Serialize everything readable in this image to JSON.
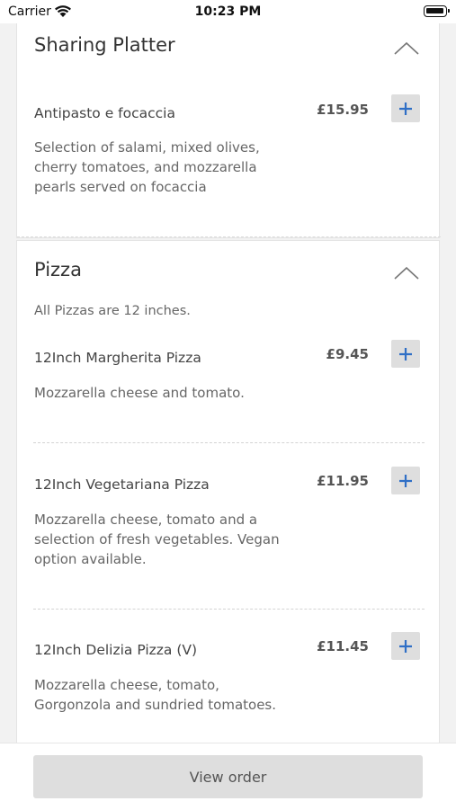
{
  "status_bar": {
    "carrier": "Carrier",
    "time": "10:23 PM"
  },
  "sections": [
    {
      "title": "Sharing Platter",
      "items": [
        {
          "name": "Antipasto e focaccia",
          "price": "£15.95",
          "description": "Selection of salami, mixed olives, cherry tomatoes, and mozzarella pearls served on focaccia"
        }
      ]
    },
    {
      "title": "Pizza",
      "subtitle": "All Pizzas are 12 inches.",
      "items": [
        {
          "name": "12Inch Margherita Pizza",
          "price": "£9.45",
          "description": "Mozzarella cheese and tomato."
        },
        {
          "name": "12Inch Vegetariana Pizza",
          "price": "£11.95",
          "description": "Mozzarella cheese, tomato and a selection of fresh vegetables. Vegan option available."
        },
        {
          "name": "12Inch Delizia Pizza (V)",
          "price": "£11.45",
          "description": "Mozzarella cheese, tomato, Gorgonzola and sundried tomatoes."
        }
      ]
    }
  ],
  "footer": {
    "button_label": "View order"
  },
  "colors": {
    "accent": "#2f6fc6",
    "button_bg": "#dedede"
  }
}
